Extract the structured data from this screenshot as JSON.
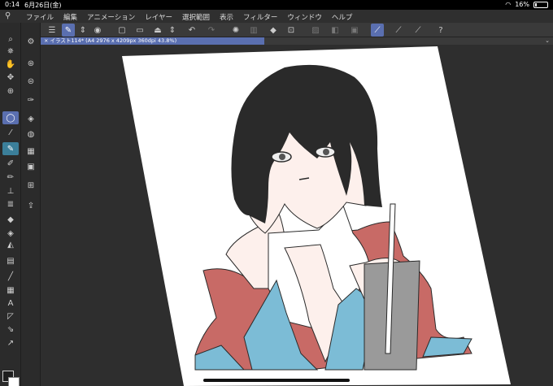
{
  "status": {
    "time": "0:14",
    "date": "6月26日(金)",
    "battery": "16%"
  },
  "menu": {
    "items": [
      "ファイル",
      "編集",
      "アニメーション",
      "レイヤー",
      "選択範囲",
      "表示",
      "フィルター",
      "ウィンドウ",
      "ヘルプ"
    ]
  },
  "document": {
    "tab_title": "× イラスト114* (A4 2976 x 4209px 360dpi 43.8%)"
  },
  "icons": {
    "toolbar": [
      "menu-icon",
      "edit-icon",
      "stepper-icon",
      "view-icon",
      "new-file-icon",
      "open-folder-icon",
      "save-icon",
      "stepper-icon",
      "undo-icon",
      "redo-icon",
      "loading-icon",
      "clear-icon",
      "fill-icon",
      "transform-icon",
      "deselect-icon",
      "invert-icon",
      "crop-icon",
      "snap-ruler-icon",
      "snap-special-icon",
      "snap-grid-icon",
      "help-icon"
    ],
    "left_tools": [
      "zoom-icon",
      "hand-icon",
      "rotate-icon",
      "move-icon",
      "select-icon",
      "lasso-icon",
      "eyedropper-icon",
      "pen-icon",
      "pencil-icon",
      "brush-icon",
      "airbrush-icon",
      "decoration-icon",
      "eraser-icon",
      "blend-icon",
      "fill-icon",
      "gradient-icon",
      "figure-icon",
      "frame-icon",
      "text-icon",
      "balloon-icon",
      "line-icon",
      "correction-icon"
    ]
  },
  "colors": {
    "accent": "#5a6fb0",
    "panel": "#2b2b2b",
    "menubar": "#2f2f2f",
    "toolbar": "#3a3a3a",
    "canvas_bg": "#2e2e2e",
    "hair": "#2a2a2a",
    "kimono_red": "#c86a66",
    "kimono_blue": "#7cbcd6",
    "skin": "#fdf0ec",
    "cup": "#9a9a9a"
  }
}
